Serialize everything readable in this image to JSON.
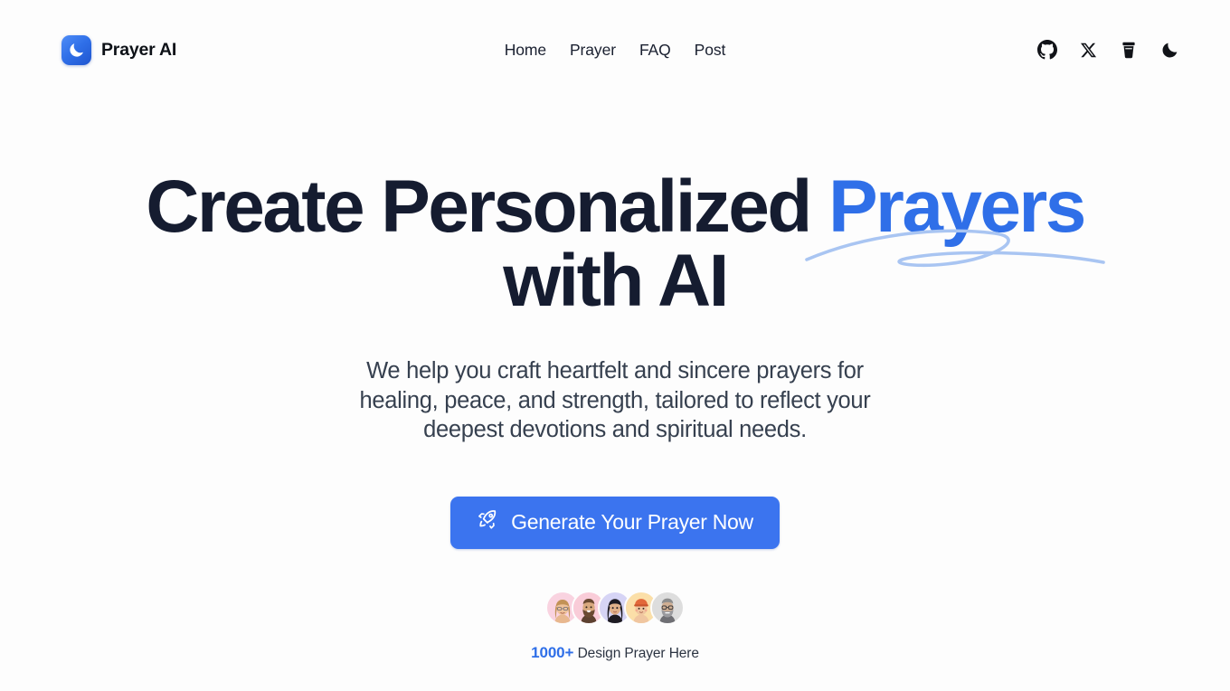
{
  "brand": {
    "name": "Prayer AI",
    "logo_icon": "crescent-moon-icon",
    "logo_gradient_from": "#4f8df7",
    "logo_gradient_to": "#1f55cf"
  },
  "nav": {
    "items": [
      {
        "label": "Home",
        "name": "nav-link-home"
      },
      {
        "label": "Prayer",
        "name": "nav-link-prayer"
      },
      {
        "label": "FAQ",
        "name": "nav-link-faq"
      },
      {
        "label": "Post",
        "name": "nav-link-post"
      }
    ]
  },
  "header_actions": [
    {
      "icon": "github-icon",
      "name": "github-link"
    },
    {
      "icon": "x-twitter-icon",
      "name": "x-twitter-link"
    },
    {
      "icon": "coffee-cup-icon",
      "name": "buy-me-a-coffee-link"
    },
    {
      "icon": "moon-icon",
      "name": "dark-mode-toggle"
    }
  ],
  "hero": {
    "headline_line1_plain": "Create Personalized ",
    "headline_accent": "Prayers",
    "headline_line2": "with AI",
    "accent_color": "#2f6fe8",
    "headline_color": "#151c30",
    "swoosh_color": "#a9c5f2",
    "subhead": "We help you craft heartfelt and sincere prayers for healing, peace, and strength, tailored to reflect your deepest devotions and spiritual needs.",
    "cta": {
      "label": "Generate Your Prayer Now",
      "icon": "rocket-icon",
      "background": "#3b74ef",
      "text_color": "#ffffff"
    }
  },
  "social_proof": {
    "avatars": [
      {
        "name": "avatar-1",
        "bg": "#f9d3e0",
        "skin": "#e8b88f",
        "hair": "#c29256",
        "style": "long-hair-glasses"
      },
      {
        "name": "avatar-2",
        "bg": "#f9ccd8",
        "skin": "#d9a97f",
        "hair": "#6b4a32",
        "style": "beard"
      },
      {
        "name": "avatar-3",
        "bg": "#d6d4f5",
        "skin": "#e0b18a",
        "hair": "#1d1b22",
        "style": "long-dark-hair"
      },
      {
        "name": "avatar-4",
        "bg": "#fbdfa8",
        "skin": "#f0c6a0",
        "hair": "#e2683a",
        "style": "orange-beanie"
      },
      {
        "name": "avatar-5",
        "bg": "#dddddd",
        "skin": "#cfae92",
        "hair": "#8d8d8d",
        "style": "gray-beard-glasses"
      }
    ],
    "count": "1000+",
    "count_color": "#2f6fe8",
    "caption": "Design Prayer Here"
  }
}
